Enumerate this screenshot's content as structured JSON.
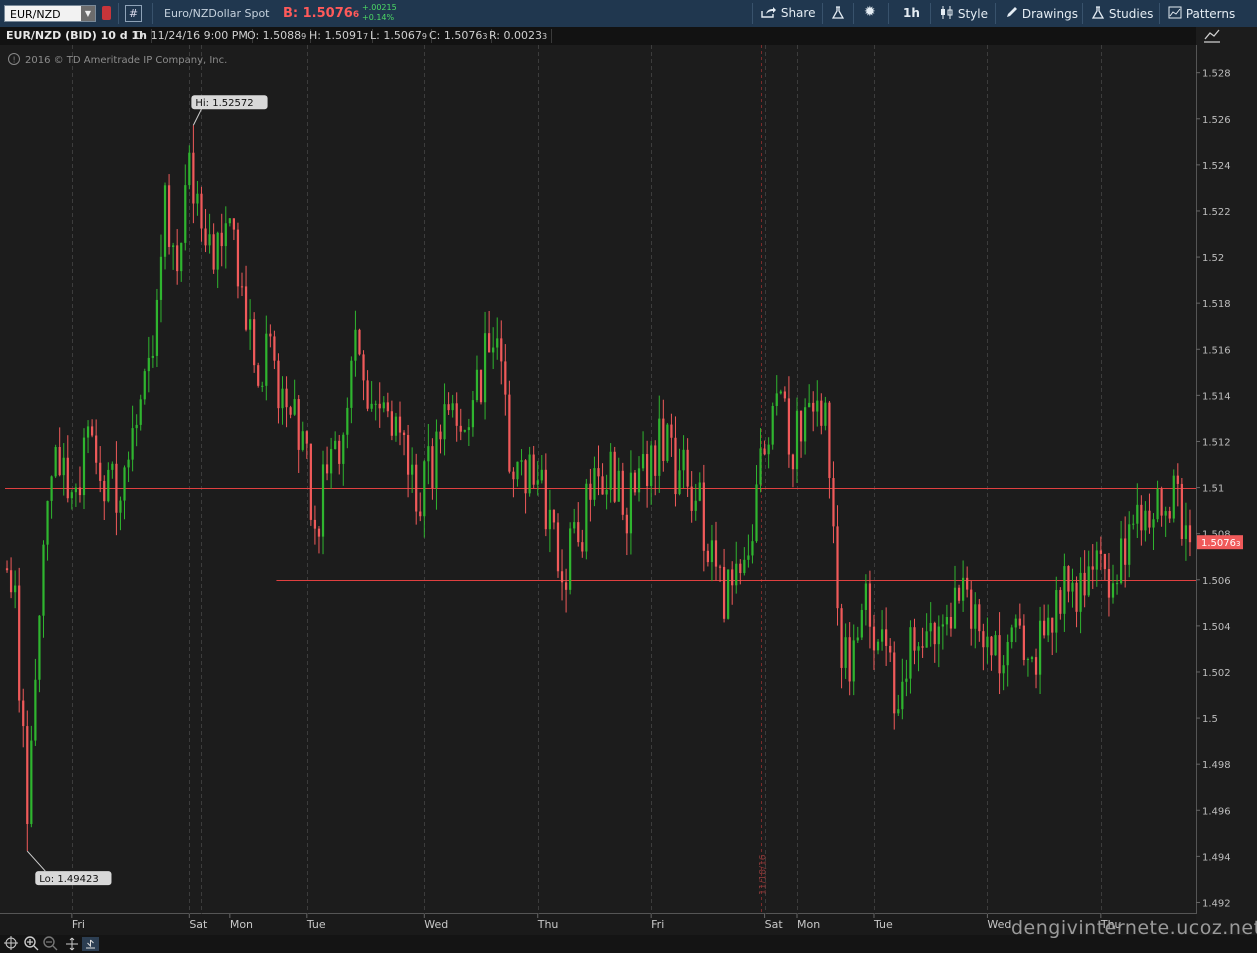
{
  "toolbar": {
    "symbol": "EUR/NZD",
    "hash_label": "#",
    "description": "Euro/NZDollar Spot",
    "bid_label": "B:",
    "bid_value": "1.5076",
    "bid_sub": "6",
    "change_abs": "+.00215",
    "change_pct": "+0.14%",
    "share_label": "Share",
    "timeframe_label": "1h",
    "style_label": "Style",
    "drawings_label": "Drawings",
    "studies_label": "Studies",
    "patterns_label": "Patterns"
  },
  "infobar": {
    "title": "EUR/NZD (BID) 10 d 1h",
    "date": "D: 11/24/16 9:00 PM",
    "open": "O: 1.5088",
    "open_sub": "9",
    "high": "H: 1.5091",
    "high_sub": "7",
    "low": "L: 1.5067",
    "low_sub": "9",
    "close": "C: 1.5076",
    "close_sub": "3",
    "range": "R: 0.0023",
    "range_sub": "3"
  },
  "copyright": "2016 © TD Ameritrade IP Company, Inc.",
  "watermark": "dengivinternete.ucoz.net",
  "colors": {
    "up": "#2fb52f",
    "down": "#f05a5a",
    "background": "#1c1c1c",
    "grid": "#3c3c3c",
    "hline": "#e04040",
    "price_label": "#f05a5a"
  },
  "chart_data": {
    "type": "candlestick",
    "y_ticks": [
      "1.528",
      "1.526",
      "1.524",
      "1.522",
      "1.52",
      "1.518",
      "1.516",
      "1.514",
      "1.512",
      "1.51",
      "1.508",
      "1.506",
      "1.504",
      "1.502",
      "1.5",
      "1.498",
      "1.496",
      "1.494",
      "1.492"
    ],
    "ylim": [
      1.4915,
      1.5292
    ],
    "x_labels": [
      "Fri",
      "Sat",
      "Mon",
      "Tue",
      "Wed",
      "Thu",
      "Fri",
      "Sat",
      "Mon",
      "Tue",
      "Wed",
      "Thu"
    ],
    "x_label_bar_index": [
      16,
      45,
      55,
      74,
      103,
      131,
      159,
      187,
      195,
      214,
      242,
      270
    ],
    "dashed_grid_bar_index": [
      16,
      45,
      48,
      74,
      103,
      131,
      159,
      187,
      195,
      214,
      242,
      270
    ],
    "date_marker": {
      "label": "11/18/16",
      "bar_index": 186
    },
    "hi_label": "Hi: 1.52572",
    "lo_label": "Lo: 1.49423",
    "hi": {
      "bar_index": 46,
      "value": 1.52572
    },
    "lo": {
      "bar_index": 5,
      "value": 1.49423
    },
    "last_price_label": "1.5076",
    "last_price_sub": "3",
    "last_price": 1.50763,
    "hlines": [
      {
        "value": 1.51,
        "from_bar": 0
      },
      {
        "value": 1.506,
        "from_bar": 67
      }
    ],
    "bars_total": 293,
    "anchors": [
      [
        0,
        1.5065
      ],
      [
        2,
        1.505
      ],
      [
        5,
        1.496
      ],
      [
        8,
        1.5045
      ],
      [
        12,
        1.512
      ],
      [
        16,
        1.509
      ],
      [
        20,
        1.512
      ],
      [
        24,
        1.51
      ],
      [
        28,
        1.51
      ],
      [
        32,
        1.512
      ],
      [
        36,
        1.516
      ],
      [
        39,
        1.522
      ],
      [
        42,
        1.52
      ],
      [
        45,
        1.5245
      ],
      [
        47,
        1.522
      ],
      [
        50,
        1.521
      ],
      [
        53,
        1.52
      ],
      [
        56,
        1.521
      ],
      [
        59,
        1.518
      ],
      [
        62,
        1.515
      ],
      [
        65,
        1.516
      ],
      [
        68,
        1.514
      ],
      [
        71,
        1.513
      ],
      [
        74,
        1.511
      ],
      [
        76,
        1.508
      ],
      [
        79,
        1.511
      ],
      [
        82,
        1.512
      ],
      [
        86,
        1.516
      ],
      [
        90,
        1.513
      ],
      [
        94,
        1.514
      ],
      [
        98,
        1.511
      ],
      [
        102,
        1.51
      ],
      [
        105,
        1.511
      ],
      [
        109,
        1.513
      ],
      [
        113,
        1.512
      ],
      [
        117,
        1.515
      ],
      [
        120,
        1.517
      ],
      [
        122,
        1.515
      ],
      [
        125,
        1.51
      ],
      [
        129,
        1.511
      ],
      [
        133,
        1.509
      ],
      [
        137,
        1.506
      ],
      [
        141,
        1.508
      ],
      [
        145,
        1.51
      ],
      [
        149,
        1.511
      ],
      [
        153,
        1.509
      ],
      [
        157,
        1.511
      ],
      [
        161,
        1.512
      ],
      [
        165,
        1.511
      ],
      [
        169,
        1.51
      ],
      [
        173,
        1.508
      ],
      [
        177,
        1.505
      ],
      [
        181,
        1.507
      ],
      [
        185,
        1.509
      ],
      [
        187,
        1.512
      ],
      [
        190,
        1.514
      ],
      [
        194,
        1.512
      ],
      [
        198,
        1.513
      ],
      [
        202,
        1.514
      ],
      [
        204,
        1.508
      ],
      [
        206,
        1.503
      ],
      [
        208,
        1.5015
      ],
      [
        211,
        1.505
      ],
      [
        214,
        1.504
      ],
      [
        217,
        1.502
      ],
      [
        220,
        1.501
      ],
      [
        223,
        1.503
      ],
      [
        227,
        1.504
      ],
      [
        231,
        1.503
      ],
      [
        235,
        1.506
      ],
      [
        238,
        1.505
      ],
      [
        241,
        1.504
      ],
      [
        245,
        1.503
      ],
      [
        249,
        1.504
      ],
      [
        253,
        1.502
      ],
      [
        256,
        1.504
      ],
      [
        259,
        1.505
      ],
      [
        263,
        1.506
      ],
      [
        266,
        1.505
      ],
      [
        270,
        1.507
      ],
      [
        274,
        1.506
      ],
      [
        277,
        1.508
      ],
      [
        280,
        1.509
      ],
      [
        283,
        1.508
      ],
      [
        286,
        1.51
      ],
      [
        289,
        1.509
      ],
      [
        292,
        1.5076
      ]
    ]
  }
}
